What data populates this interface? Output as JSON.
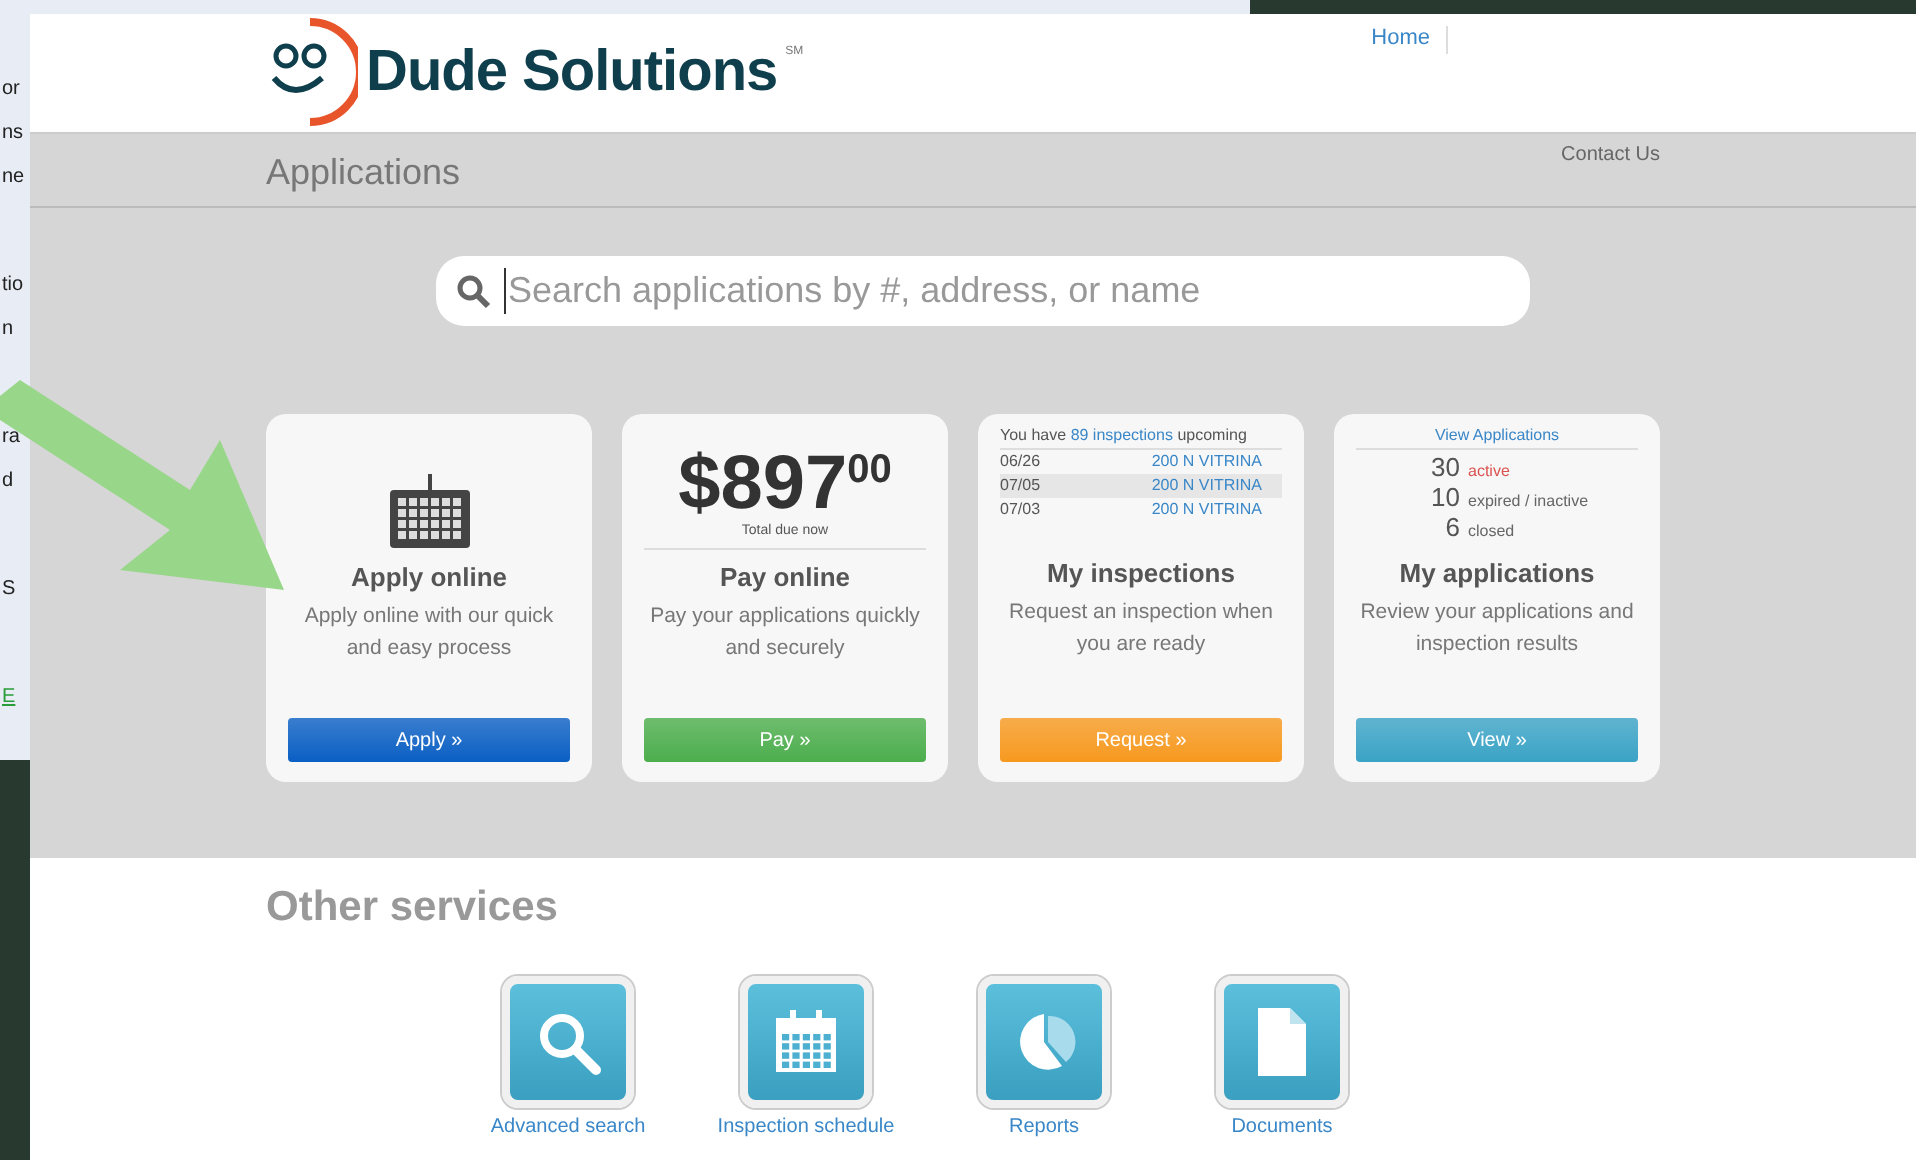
{
  "background_page": {
    "paragraphs": [
      [
        {
          "kind": "text",
          "text": "or"
        },
        {
          "kind": "text",
          "text": "ns"
        },
        {
          "kind": "text",
          "text": "ne"
        }
      ],
      [
        {
          "kind": "text",
          "text": "tio"
        },
        {
          "kind": "text",
          "text": "n"
        }
      ],
      [
        {
          "kind": "text",
          "text": "ra"
        },
        {
          "kind": "text",
          "text": "d"
        }
      ],
      [
        {
          "kind": "text",
          "text": "S"
        }
      ],
      [
        {
          "kind": "link",
          "text": "E"
        }
      ]
    ]
  },
  "header": {
    "brand": "Dude Solutions",
    "brand_mark": "SM",
    "nav": [
      {
        "label": "Home"
      }
    ]
  },
  "section": {
    "title": "Applications",
    "contact": "Contact Us"
  },
  "search": {
    "placeholder": "Search applications by #, address, or name"
  },
  "cards": [
    {
      "kind": "apply",
      "title": "Apply online",
      "text": "Apply online with our quick and easy process",
      "button": "Apply »",
      "color": "#0a5fc4"
    },
    {
      "kind": "pay",
      "amount": "$897",
      "cents": "00",
      "amount_label": "Total due now",
      "title": "Pay online",
      "text": "Pay your applications quickly and securely",
      "button": "Pay »",
      "color": "#4cae4c"
    },
    {
      "kind": "inspections",
      "summary": {
        "before": "You have",
        "link": "89 inspections",
        "after": "upcoming"
      },
      "rows": [
        {
          "date": "06/26",
          "address": "200 N VITRINA",
          "highlighted": false
        },
        {
          "date": "07/05",
          "address": "200 N VITRINA",
          "highlighted": true
        },
        {
          "date": "07/03",
          "address": "200 N VITRINA",
          "highlighted": false
        }
      ],
      "title": "My inspections",
      "text": "Request an inspection when you are ready",
      "button": "Request »",
      "color": "#f7991f"
    },
    {
      "kind": "applications",
      "link": "View Applications",
      "counts": [
        {
          "count": "30",
          "label": "active",
          "color": "#d9534f"
        },
        {
          "count": "10",
          "label": "expired / inactive",
          "color": "#666666"
        },
        {
          "count": "6",
          "label": "closed",
          "color": "#666666"
        }
      ],
      "title": "My applications",
      "text": "Review your applications and inspection results",
      "button": "View »",
      "color": "#3aa3c6"
    }
  ],
  "other_services": {
    "title": "Other services",
    "items": [
      {
        "kind": "search",
        "label": "Advanced search"
      },
      {
        "kind": "calendar",
        "label": "Inspection schedule"
      },
      {
        "kind": "chart",
        "label": "Reports"
      },
      {
        "kind": "document",
        "label": "Documents"
      }
    ]
  }
}
